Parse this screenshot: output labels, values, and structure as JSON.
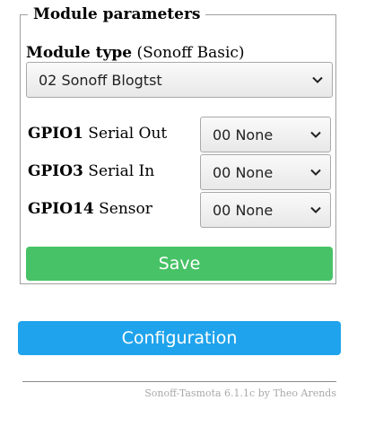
{
  "module": {
    "legend": "Module parameters",
    "type_label": "Module type",
    "type_default": "(Sonoff Basic)",
    "type_selected": "02 Sonoff Blogtst"
  },
  "gpios": [
    {
      "name": "GPIO1",
      "function": "Serial Out",
      "selected": "00 None"
    },
    {
      "name": "GPIO3",
      "function": "Serial In",
      "selected": "00 None"
    },
    {
      "name": "GPIO14",
      "function": "Sensor",
      "selected": "00 None"
    }
  ],
  "buttons": {
    "save": "Save",
    "configuration": "Configuration"
  },
  "footer": {
    "text": "Sonoff-Tasmota 6.1.1c by Theo Arends"
  },
  "colors": {
    "save": "#47c266",
    "configuration": "#1fa3ec",
    "footer_text": "#a8a8a8"
  },
  "icons": {
    "dropdown": "chevron-down-icon"
  }
}
